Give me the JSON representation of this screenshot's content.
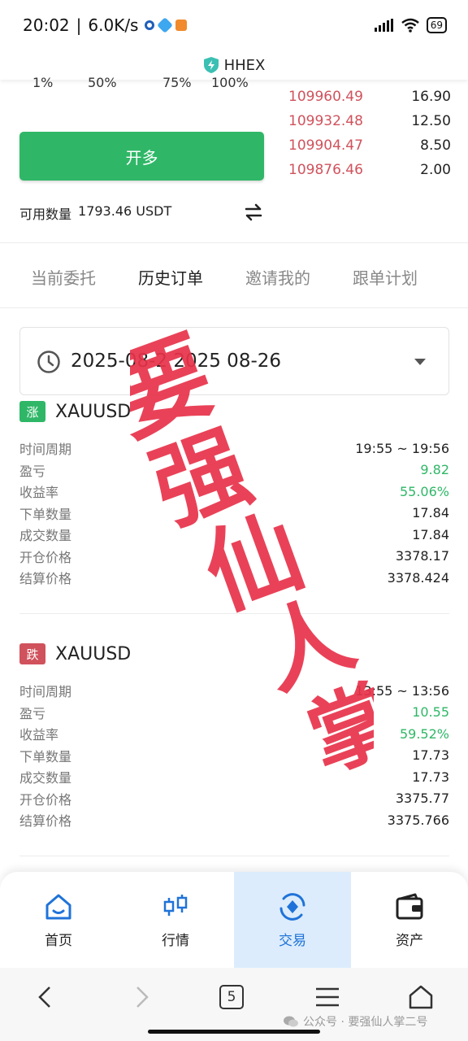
{
  "status_bar": {
    "time": "20:02",
    "speed": "6.0K/s",
    "battery": "69"
  },
  "app": {
    "title": "HHEX"
  },
  "leverage_percents": [
    "1%",
    "50%",
    "75%",
    "100%"
  ],
  "orderbook": [
    {
      "price": "109960.49",
      "qty": "16.90"
    },
    {
      "price": "109932.48",
      "qty": "12.50"
    },
    {
      "price": "109904.47",
      "qty": "8.50"
    },
    {
      "price": "109876.46",
      "qty": "2.00"
    }
  ],
  "open_long_label": "开多",
  "available": {
    "label": "可用数量",
    "value": "1793.46 USDT"
  },
  "tabs": [
    "当前委托",
    "历史订单",
    "邀请我的",
    "跟单计划"
  ],
  "date_range": "2025-08-2    2025 08-26",
  "orders": [
    {
      "badge": "涨",
      "symbol": "XAUUSD",
      "rows": [
        {
          "label": "时间周期",
          "value": "19:55 ~ 19:56"
        },
        {
          "label": "盈亏",
          "value": "9.82"
        },
        {
          "label": "收益率",
          "value": "55.06%"
        },
        {
          "label": "下单数量",
          "value": "17.84"
        },
        {
          "label": "成交数量",
          "value": "17.84"
        },
        {
          "label": "开仓价格",
          "value": "3378.17"
        },
        {
          "label": "结算价格",
          "value": "3378.424"
        }
      ]
    },
    {
      "badge": "跌",
      "symbol": "XAUUSD",
      "rows": [
        {
          "label": "时间周期",
          "value": "13:55 ~ 13:56"
        },
        {
          "label": "盈亏",
          "value": "10.55"
        },
        {
          "label": "收益率",
          "value": "59.52%"
        },
        {
          "label": "下单数量",
          "value": "17.73"
        },
        {
          "label": "成交数量",
          "value": "17.73"
        },
        {
          "label": "开仓价格",
          "value": "3375.77"
        },
        {
          "label": "结算价格",
          "value": "3375.766"
        }
      ]
    }
  ],
  "watermark": "要强仙人掌",
  "bottom_nav": [
    "首页",
    "行情",
    "交易",
    "资产"
  ],
  "system_nav": {
    "tab_count": "5"
  },
  "wechat_credit": "公众号 · 要强仙人掌二号",
  "colors": {
    "buy_green": "#2fb767",
    "sell_red": "#d0525c",
    "active_blue": "#1f73d8",
    "watermark_red": "#e8334a"
  }
}
